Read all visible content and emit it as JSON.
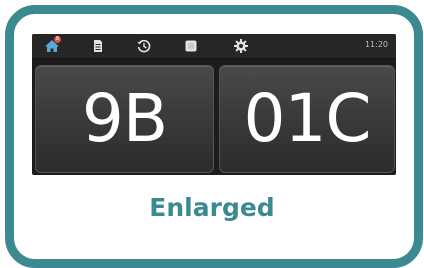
{
  "statusbar": {
    "icons": [
      {
        "name": "home-icon",
        "color": "#56a9d8",
        "badge": "8"
      },
      {
        "name": "document-icon",
        "color": "#e2e2e2"
      },
      {
        "name": "history-icon",
        "color": "#e2e2e2"
      },
      {
        "name": "stop-icon",
        "color": "#e2e2e2"
      },
      {
        "name": "gear-icon",
        "color": "#e2e2e2"
      }
    ],
    "time": "11:20"
  },
  "display": {
    "left_value": "9B",
    "right_value": "01C"
  },
  "caption": "Enlarged",
  "colors": {
    "frame": "#3b8a91",
    "screen_bg": "#1c1c1c",
    "accent_home": "#56a9d8"
  }
}
